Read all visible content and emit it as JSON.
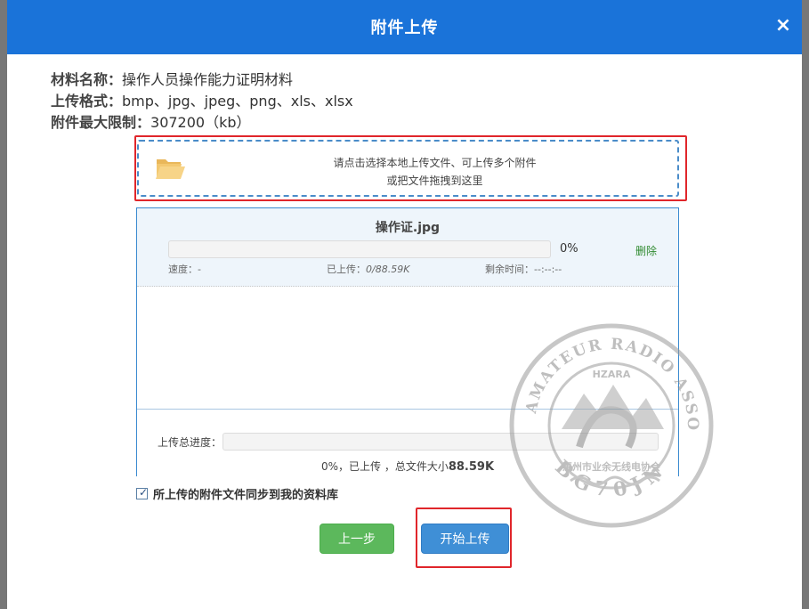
{
  "dialog": {
    "title": "附件上传",
    "close_glyph": "×"
  },
  "info": {
    "material_name_label": "材料名称：",
    "material_name_value": "操作人员操作能力证明材料",
    "upload_format_label": "上传格式：",
    "upload_format_value": "bmp、jpg、jpeg、png、xls、xlsx",
    "max_size_label": "附件最大限制：",
    "max_size_value": "307200（kb）"
  },
  "dropzone": {
    "line1": "请点击选择本地上传文件、可上传多个附件",
    "line2": "或把文件拖拽到这里",
    "icon": "folder-open-icon"
  },
  "files": [
    {
      "name": "操作证.jpg",
      "progress_percent": 0,
      "percent_text": "0%",
      "delete_label": "删除",
      "speed_label": "速度：",
      "speed_value": "-",
      "uploaded_label": "已上传：",
      "uploaded_value": "0/88.59K",
      "remaining_label": "剩余时间：",
      "remaining_value": "--:--:--"
    }
  ],
  "total": {
    "label": "上传总进度：",
    "progress_percent": 0,
    "summary_prefix": "0%，已上传 ，总文件大小",
    "total_size": "88.59K"
  },
  "sync": {
    "checked": true,
    "label": "所上传的附件文件同步到我的资料库"
  },
  "buttons": {
    "prev_label": "上一步",
    "start_label": "开始上传"
  },
  "watermark": {
    "top_text": "HUIZHOU AMATEUR RADIO ASSOCIATION",
    "abbr": "HZARA",
    "cn_name": "惠州市业余无线电协会",
    "callsign": "BG70JN"
  },
  "colors": {
    "header": "#1a73d9",
    "highlight": "#e0262b",
    "dashed": "#4a8cc9",
    "green_button": "#5cb85c",
    "blue_button": "#3f8fd6"
  }
}
